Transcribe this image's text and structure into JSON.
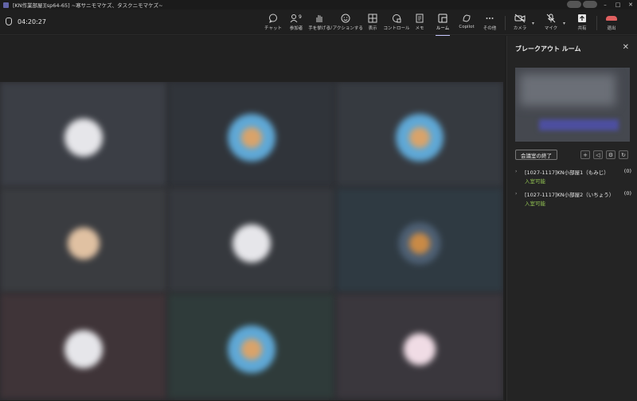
{
  "window": {
    "title": "[KN作業部屋][sp64-65] ~寒サニモマケズ、タスクニモマケズ~",
    "controls": [
      "–",
      "□",
      "✕"
    ]
  },
  "toolbar": {
    "timer": "04:20:27",
    "participant_count": "9",
    "items": [
      {
        "label": "チャット",
        "icon": "chat-icon"
      },
      {
        "label": "参加者",
        "icon": "people-icon"
      },
      {
        "label": "手を挙げる",
        "icon": "raise-hand-icon"
      },
      {
        "label": "リアクションする",
        "icon": "reaction-icon"
      },
      {
        "label": "表示",
        "icon": "view-icon"
      },
      {
        "label": "コントロール",
        "icon": "control-icon"
      },
      {
        "label": "メモ",
        "icon": "notes-icon"
      },
      {
        "label": "ルーム",
        "icon": "rooms-icon"
      },
      {
        "label": "Copilot",
        "icon": "copilot-icon"
      },
      {
        "label": "その他",
        "icon": "more-icon"
      },
      {
        "label": "カメラ",
        "icon": "camera-icon"
      },
      {
        "label": "マイク",
        "icon": "mic-off-icon"
      },
      {
        "label": "共有",
        "icon": "share-icon"
      },
      {
        "label": "退出",
        "icon": "leave-icon"
      }
    ],
    "active": "ルーム"
  },
  "panel": {
    "title": "ブレークアウト ルーム",
    "end_button": "会議室の終了",
    "tool_icons": [
      "add-icon",
      "announce-icon",
      "settings-icon",
      "refresh-icon"
    ],
    "rooms": [
      {
        "name": "[1027-1117]KN小部屋1（もみじ）",
        "count": "(0)",
        "status": "入室可能"
      },
      {
        "name": "[1027-1117]KN小部屋2（いちょう）",
        "count": "(0)",
        "status": "入室可能"
      }
    ]
  },
  "colors": {
    "accent": "#c7c8ff",
    "available": "#92c353",
    "leave": "#e06060"
  }
}
